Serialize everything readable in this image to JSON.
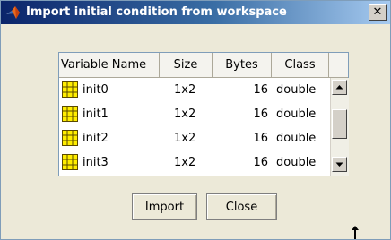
{
  "window": {
    "title": "Import initial condition from workspace",
    "close_glyph": "✕"
  },
  "table": {
    "columns": [
      "Variable Name",
      "Size",
      "Bytes",
      "Class"
    ],
    "rows": [
      {
        "icon": "matrix-grid-icon",
        "name": "init0",
        "size": "1x2",
        "bytes": "16",
        "class": "double"
      },
      {
        "icon": "matrix-grid-icon",
        "name": "init1",
        "size": "1x2",
        "bytes": "16",
        "class": "double"
      },
      {
        "icon": "matrix-grid-icon",
        "name": "init2",
        "size": "1x2",
        "bytes": "16",
        "class": "double"
      },
      {
        "icon": "matrix-grid-icon",
        "name": "init3",
        "size": "1x2",
        "bytes": "16",
        "class": "double"
      }
    ]
  },
  "buttons": {
    "import_label": "Import",
    "close_label": "Close"
  },
  "colors": {
    "title_gradient_start": "#0a246a",
    "title_gradient_end": "#a6caf0",
    "dialog_bg": "#ece9d8",
    "grid_icon_fill": "#ffee00"
  }
}
